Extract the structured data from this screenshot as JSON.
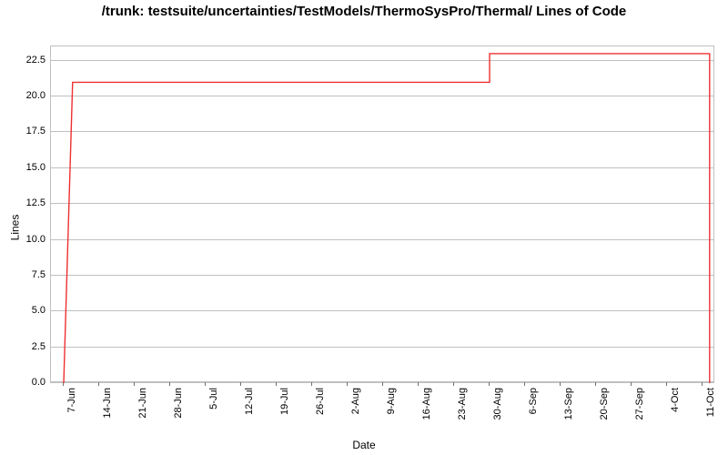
{
  "chart_data": {
    "type": "line",
    "title": "/trunk: testsuite/uncertainties/TestModels/ThermoSysPro/Thermal/\nLines of Code",
    "xlabel": "Date",
    "ylabel": "Lines",
    "ylim": [
      0.0,
      23.5
    ],
    "y_ticks": [
      0.0,
      2.5,
      5.0,
      7.5,
      10.0,
      12.5,
      15.0,
      17.5,
      20.0,
      22.5
    ],
    "x_categories": [
      "7-Jun",
      "14-Jun",
      "21-Jun",
      "28-Jun",
      "5-Jul",
      "12-Jul",
      "19-Jul",
      "26-Jul",
      "2-Aug",
      "9-Aug",
      "16-Aug",
      "23-Aug",
      "30-Aug",
      "6-Sep",
      "13-Sep",
      "20-Sep",
      "27-Sep",
      "4-Oct",
      "11-Oct"
    ],
    "series": [
      {
        "name": "loc",
        "color": "#ee3030",
        "data": [
          {
            "xi": 0.0,
            "y": 0
          },
          {
            "xi": 0.25,
            "y": 21
          },
          {
            "xi": 12.0,
            "y": 21
          },
          {
            "xi": 12.0,
            "y": 23
          },
          {
            "xi": 18.2,
            "y": 23
          },
          {
            "xi": 18.2,
            "y": 0
          }
        ]
      }
    ]
  }
}
